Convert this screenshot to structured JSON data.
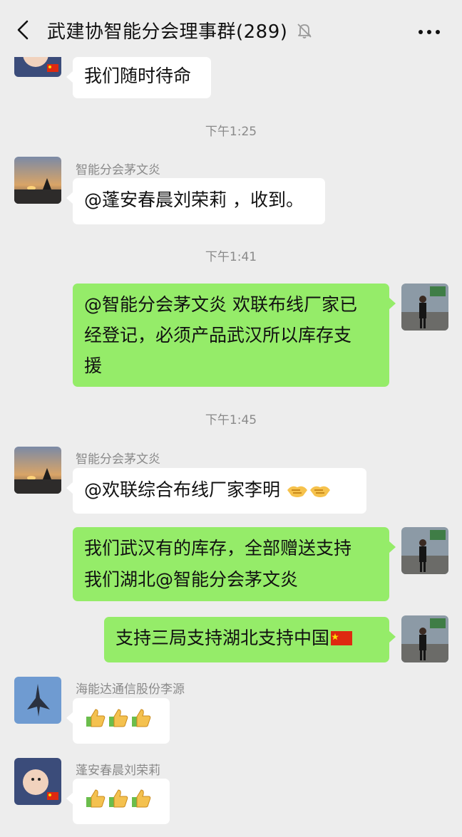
{
  "header": {
    "title": "武建协智能分会理事群(289)"
  },
  "messages": {
    "m0": {
      "text": "我们随时待命"
    },
    "ts1": "下午1:25",
    "m1": {
      "sender": "智能分会茅文炎",
      "text": "@蓬安春晨刘荣莉 ，收到。"
    },
    "ts2": "下午1:41",
    "m2": {
      "line1": "@智能分会茅文炎  欢联布线厂家已",
      "line2": "经登记，必须产品武汉所以库存支",
      "line3": "援"
    },
    "ts3": "下午1:45",
    "m3": {
      "sender": "智能分会茅文炎",
      "text": "@欢联综合布线厂家李明 "
    },
    "m4": {
      "line1": "我们武汉有的库存，全部赠送支持",
      "line2": "我们湖北@智能分会茅文炎"
    },
    "m5": {
      "text": "支持三局支持湖北支持中国"
    },
    "m6": {
      "sender": "海能达通信股份李源"
    },
    "m7": {
      "sender": "蓬安春晨刘荣莉"
    }
  },
  "colors": {
    "background": "#ededed",
    "bubble_in": "#ffffff",
    "bubble_out": "#95ec69"
  },
  "icons": [
    "back-icon",
    "mute-icon",
    "more-icon",
    "handshake-icon",
    "thumbs-up-icon",
    "china-flag-icon"
  ]
}
